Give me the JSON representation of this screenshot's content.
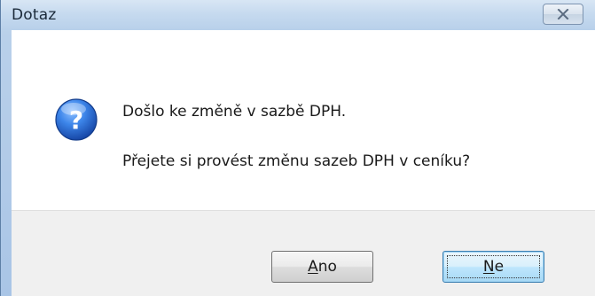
{
  "window": {
    "title": "Dotaz"
  },
  "message": {
    "line1": "Došlo ke změně v sazbě DPH.",
    "line2": "Přejete si provést změnu sazeb DPH v ceníku?"
  },
  "buttons": {
    "yes": {
      "mnemonic": "A",
      "rest": "no"
    },
    "no": {
      "mnemonic": "N",
      "rest": "e"
    }
  },
  "icons": {
    "dialog": "question-icon",
    "close": "close-icon"
  },
  "colors": {
    "icon_blue": "#2a6fd6",
    "focus_button": "#3c7fb1"
  }
}
